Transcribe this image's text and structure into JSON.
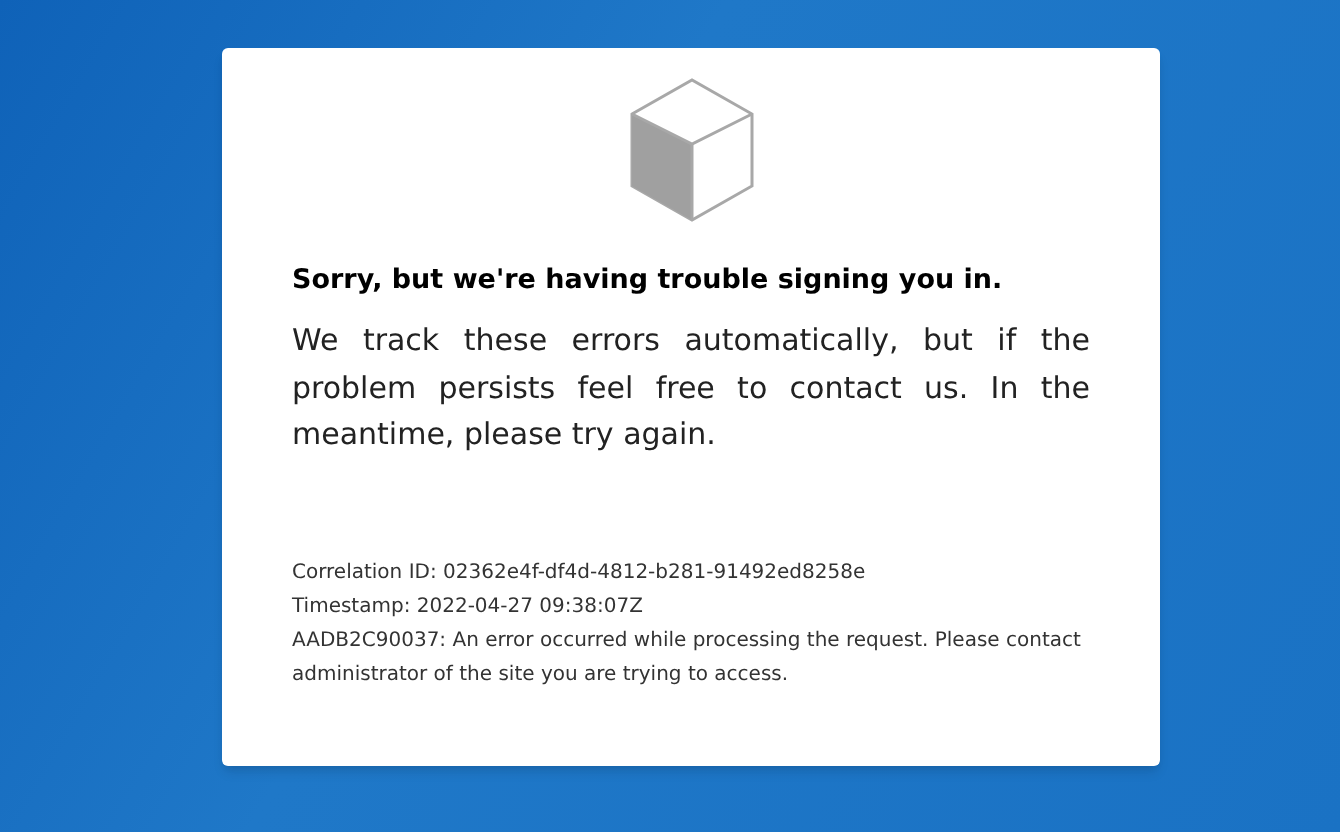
{
  "heading": "Sorry, but we're having trouble signing you in.",
  "message": "We track these errors automatically, but if the problem persists feel free to contact us. In the meantime, please try again.",
  "details": [
    "Correlation ID: 02362e4f-df4d-4812-b281-91492ed8258e",
    "Timestamp: 2022-04-27 09:38:07Z",
    "AADB2C90037: An error occurred while processing the request. Please contact administrator of the site you are trying to access."
  ]
}
